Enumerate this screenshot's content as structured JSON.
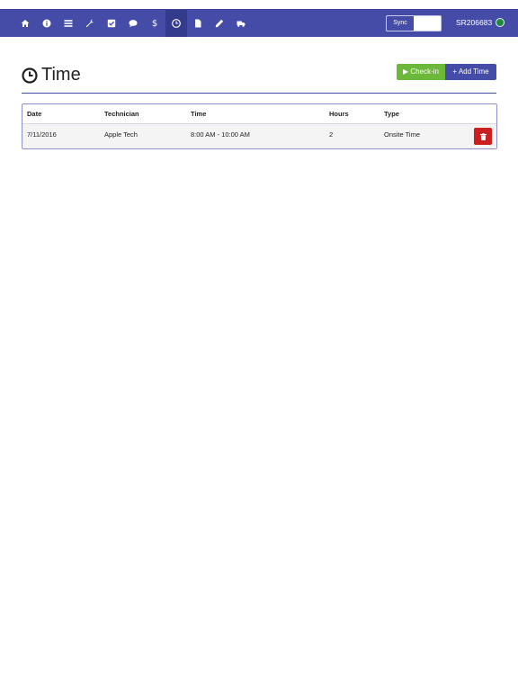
{
  "navbar": {
    "items": [
      {
        "name": "home-icon"
      },
      {
        "name": "info-icon"
      },
      {
        "name": "list-icon"
      },
      {
        "name": "wrench-icon"
      },
      {
        "name": "checkbox-icon"
      },
      {
        "name": "comment-icon"
      },
      {
        "name": "dollar-icon",
        "glyph": "$"
      },
      {
        "name": "clock-icon",
        "active": true
      },
      {
        "name": "document-icon"
      },
      {
        "name": "pencil-icon"
      },
      {
        "name": "truck-icon"
      }
    ],
    "sync_label": "Sync",
    "sr_number": "SR206683",
    "status_color": "#1f8a3a"
  },
  "page": {
    "title": "Time",
    "checkin_label": "▶ Check-in",
    "addtime_label": "+ Add Time"
  },
  "table": {
    "headers": {
      "date": "Date",
      "technician": "Technician",
      "time": "Time",
      "hours": "Hours",
      "type": "Type"
    },
    "rows": [
      {
        "date": "7/11/2016",
        "technician": "Apple Tech",
        "time": "8:00 AM - 10:00 AM",
        "hours": "2",
        "type": "Onsite Time"
      }
    ]
  },
  "colors": {
    "brand": "#454ca8",
    "checkin": "#6bb83a",
    "delete": "#cc2020"
  }
}
